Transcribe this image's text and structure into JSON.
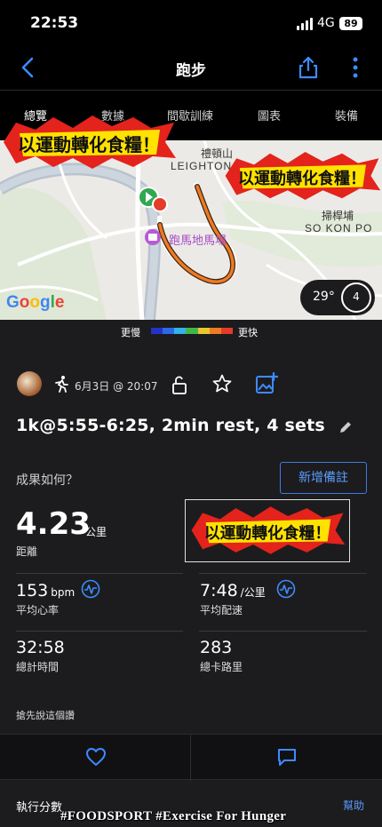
{
  "status_bar": {
    "time": "22:53",
    "network": "4G",
    "battery": "89"
  },
  "nav": {
    "title": "跑步",
    "back_icon": "chevron-left-icon",
    "share_icon": "share-icon",
    "more_icon": "more-vertical-icon"
  },
  "tabs": [
    {
      "label": "總覽",
      "active": true
    },
    {
      "label": "數據",
      "active": false
    },
    {
      "label": "間歇訓練",
      "active": false
    },
    {
      "label": "圖表",
      "active": false
    },
    {
      "label": "裝備",
      "active": false
    }
  ],
  "map": {
    "places": {
      "top": "禮頓山",
      "leighton": "LEIGHTON",
      "so_kon_po_zh": "掃桿埔",
      "so_kon_po": "SO KON PO",
      "racecourse": "跑馬地馬場"
    },
    "google": "Google",
    "temperature": "29°",
    "wind": "4"
  },
  "pace_legend": {
    "slow": "更慢",
    "fast": "更快",
    "colors": [
      "#2333c7",
      "#2c69e8",
      "#33b3e6",
      "#3fb84a",
      "#e8c72c",
      "#ef7a22",
      "#e53b28"
    ]
  },
  "activity": {
    "date": "6月3日 @ 20:07",
    "title": "1k@5:55-6:25, 2min rest, 4 sets"
  },
  "feedback": {
    "question": "成果如何？",
    "add_note": "新增備註"
  },
  "stats": {
    "distance": {
      "value": "4.23",
      "unit": "公里",
      "label": "距離"
    },
    "avg_hr": {
      "value": "153",
      "unit": "bpm",
      "label": "平均心率"
    },
    "avg_pace": {
      "value": "7:48",
      "unit": "/公里",
      "label": "平均配速"
    },
    "total_time": {
      "value": "32:58",
      "label": "總計時間"
    },
    "calories": {
      "value": "283",
      "label": "總卡路里"
    }
  },
  "hint": "搶先說這個讚",
  "bottom": {
    "exec_score": "執行分數",
    "help": "幫助"
  },
  "watermark": "#FOODSPORT #Exercise For Hunger",
  "stamp_text": "以運動轉化食糧！",
  "accent": "#2e7bf6"
}
